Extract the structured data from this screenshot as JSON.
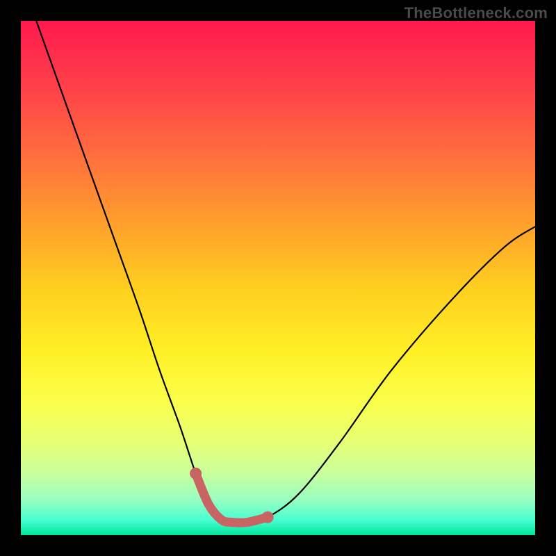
{
  "watermark": "TheBottleneck.com",
  "chart_data": {
    "type": "line",
    "title": "",
    "xlabel": "",
    "ylabel": "",
    "xlim": [
      0,
      100
    ],
    "ylim": [
      0,
      100
    ],
    "series": [
      {
        "name": "bottleneck-curve",
        "x": [
          3,
          8,
          13,
          18,
          23,
          27,
          31,
          34,
          36.5,
          39,
          41,
          44,
          48,
          54,
          62,
          72,
          84,
          94,
          100
        ],
        "values": [
          100,
          86,
          72,
          58,
          44,
          32,
          21,
          12,
          6,
          3,
          2.5,
          2.5,
          3.5,
          8,
          18,
          32,
          46,
          56,
          60
        ]
      },
      {
        "name": "optimal-range",
        "x": [
          34,
          36.5,
          39,
          41,
          44,
          48
        ],
        "values": [
          12,
          6,
          3,
          2.5,
          2.5,
          3.5
        ]
      }
    ],
    "annotations": []
  },
  "colors": {
    "curve": "#000000",
    "optimal_range": "#c96464",
    "frame": "#000000"
  }
}
